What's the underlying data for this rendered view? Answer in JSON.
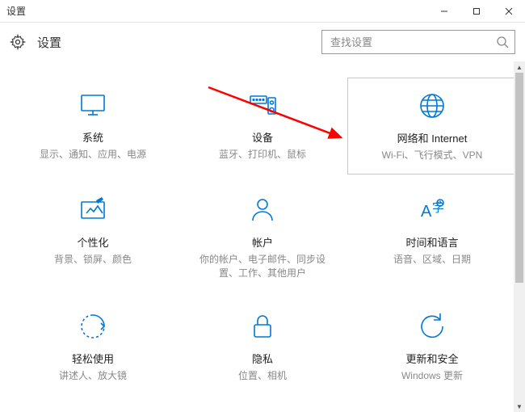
{
  "window_title": "设置",
  "page_title": "设置",
  "search": {
    "placeholder": "查找设置"
  },
  "tiles": {
    "system": {
      "title": "系统",
      "desc": "显示、通知、应用、电源"
    },
    "devices": {
      "title": "设备",
      "desc": "蓝牙、打印机、鼠标"
    },
    "network": {
      "title": "网络和 Internet",
      "desc": "Wi-Fi、飞行模式、VPN"
    },
    "personalization": {
      "title": "个性化",
      "desc": "背景、锁屏、颜色"
    },
    "accounts": {
      "title": "帐户",
      "desc": "你的帐户、电子邮件、同步设置、工作、其他用户"
    },
    "time_language": {
      "title": "时间和语言",
      "desc": "语音、区域、日期"
    },
    "ease": {
      "title": "轻松使用",
      "desc": "讲述人、放大镜"
    },
    "privacy": {
      "title": "隐私",
      "desc": "位置、相机"
    },
    "update": {
      "title": "更新和安全",
      "desc": "Windows 更新"
    }
  }
}
